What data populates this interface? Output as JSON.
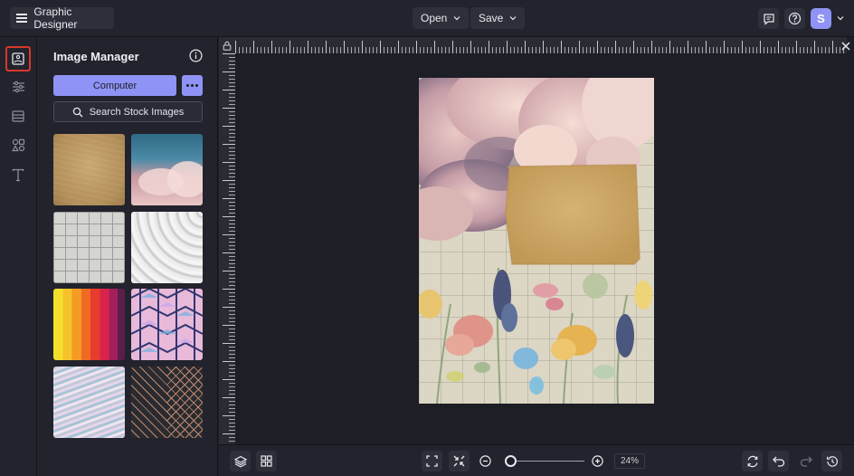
{
  "header": {
    "app_title": "Graphic Designer",
    "open_label": "Open",
    "save_label": "Save",
    "avatar_initial": "S"
  },
  "rail": {
    "items": [
      {
        "name": "images",
        "icon": "image-icon",
        "active": true
      },
      {
        "name": "adjustments",
        "icon": "sliders-icon",
        "active": false
      },
      {
        "name": "backgrounds",
        "icon": "layout-icon",
        "active": false
      },
      {
        "name": "graphics",
        "icon": "shapes-icon",
        "active": false
      },
      {
        "name": "text",
        "icon": "text-icon",
        "active": false
      }
    ]
  },
  "panel": {
    "title": "Image Manager",
    "computer_label": "Computer",
    "stock_label": "Search Stock Images",
    "thumbnails": [
      "kraft paper texture",
      "pink clouds on blue sky",
      "grid paper",
      "white abstract waves",
      "rainbow stripes",
      "geometric triangles pattern",
      "holographic wavy texture",
      "rose gold chevron pattern"
    ]
  },
  "footer": {
    "zoom_value": "24%",
    "zoom_fraction": 0.05
  },
  "colors": {
    "accent": "#8f93f5",
    "active_outline": "#d8382c",
    "background": "#1d1e26",
    "panel": "#22232c"
  }
}
